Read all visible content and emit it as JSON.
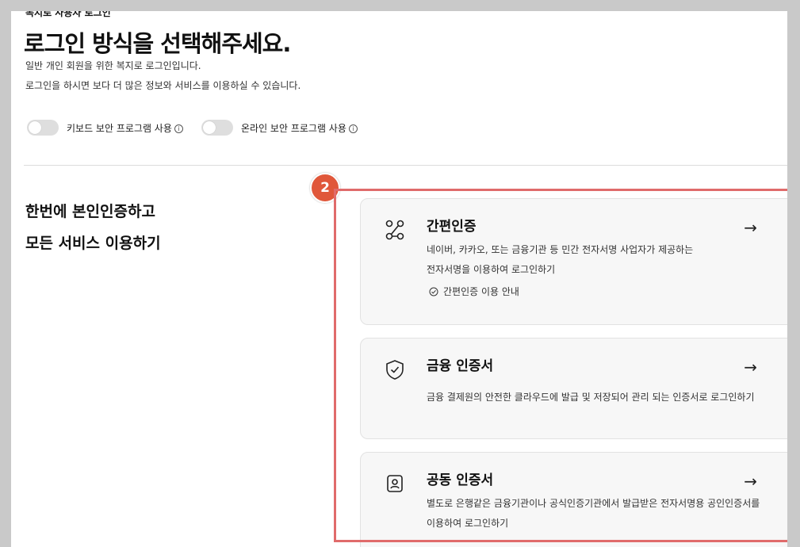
{
  "header": {
    "breadcrumb": "복지로 사용자 로그인",
    "title": "로그인 방식을 선택해주세요.",
    "desc1": "일반 개인 회원을 위한 복지로 로그인입니다.",
    "desc2": "로그인을 하시면 보다 더 많은 정보와 서비스를 이용하실 수 있습니다."
  },
  "toggles": [
    {
      "label": "키보드 보안 프로그램 사용",
      "on": false
    },
    {
      "label": "온라인 보안 프로그램 사용",
      "on": false
    }
  ],
  "promo": {
    "line1": "한번에 본인인증하고",
    "line2": "모든 서비스 이용하기"
  },
  "badge": "2",
  "cards": [
    {
      "title": "간편인증",
      "icon": "route-icon",
      "desc_line1": "네이버, 카카오, 또는 금융기관 등 민간 전자서명 사업자가 제공하는",
      "desc_line2": "전자서명을 이용하여 로그인하기",
      "guide": "간편인증 이용 안내",
      "arrow": "→"
    },
    {
      "title": "금융 인증서",
      "icon": "shield-check-icon",
      "desc_line1": "금융 결제원의 안전한 클라우드에 발급 및 저장되어 관리 되는 인증서로 로그인하기",
      "arrow": "→"
    },
    {
      "title": "공동 인증서",
      "icon": "id-card-icon",
      "desc_line1": "별도로 은행같은 금융기관이나 공식인증기관에서 발급받은 전자서명용 공인인증서를",
      "desc_line2": "이용하여 로그인하기",
      "arrow": "→"
    }
  ],
  "colors": {
    "badge": "#e0573a",
    "highlight": "#e06b6b",
    "card_bg": "#f7f7f7"
  }
}
